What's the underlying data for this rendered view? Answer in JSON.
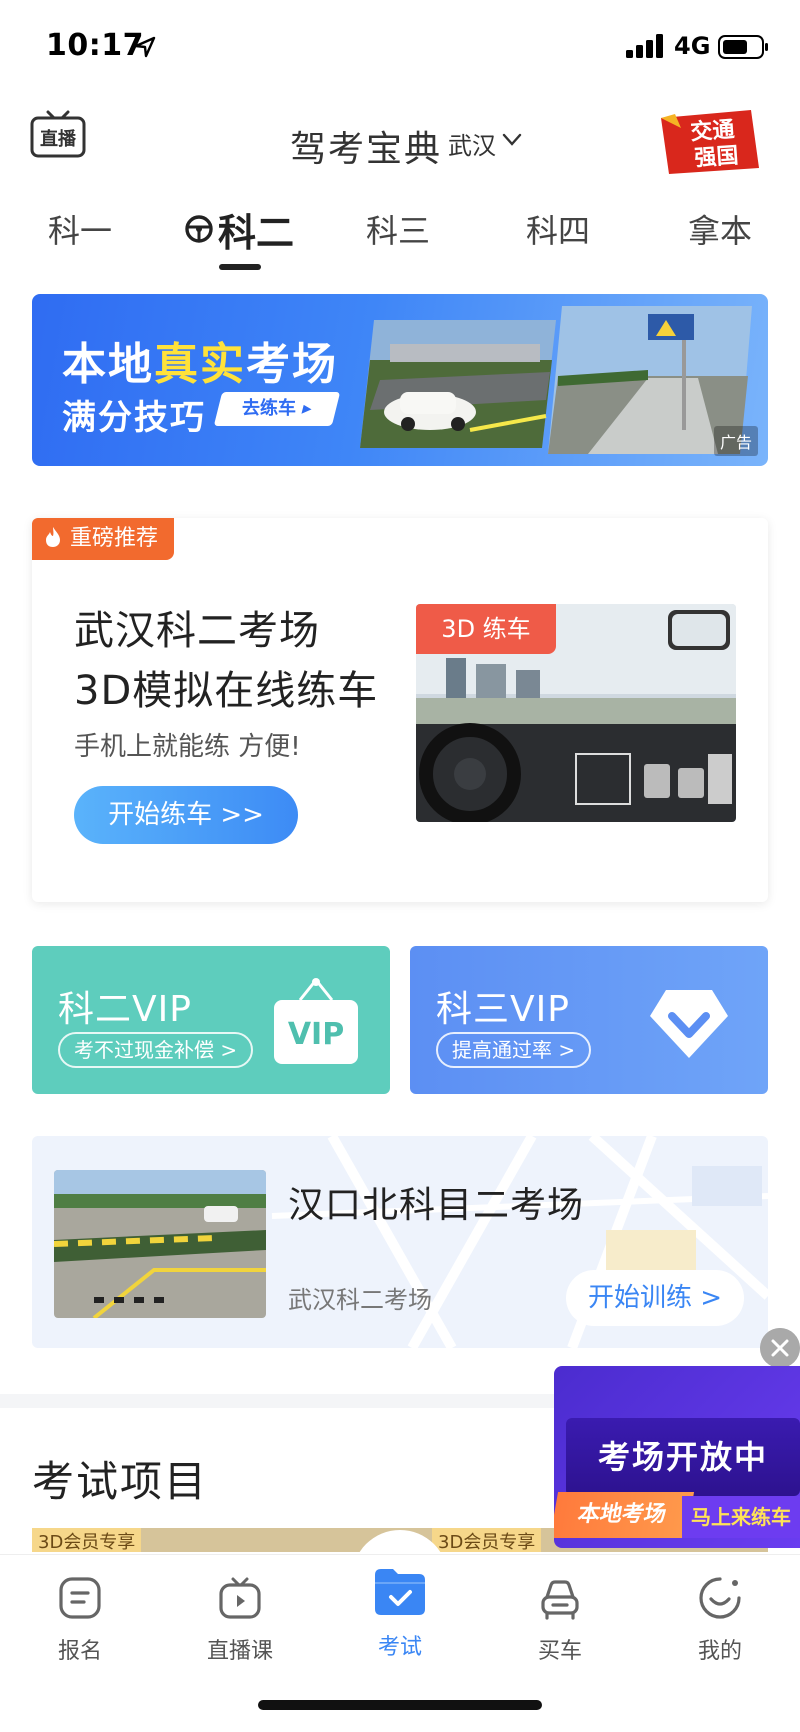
{
  "status_bar": {
    "time": "10:17",
    "network": "4G"
  },
  "header": {
    "live_label": "直播",
    "title": "驾考宝典",
    "city": "武汉",
    "badge_text_1": "交通",
    "badge_text_2": "强国"
  },
  "tabs": [
    {
      "label": "科一",
      "active": false
    },
    {
      "label": "科二",
      "active": true
    },
    {
      "label": "科三",
      "active": false
    },
    {
      "label": "科四",
      "active": false
    },
    {
      "label": "拿本",
      "active": false
    }
  ],
  "banner": {
    "line1_a": "本地",
    "line1_b": "真实",
    "line1_c": "考场",
    "line2": "满分技巧",
    "button": "去练车",
    "ad_label": "广告"
  },
  "recommend": {
    "tag": "重磅推荐",
    "title_line1": "武汉科二考场",
    "title_line2": "3D模拟在线练车",
    "subtitle": "手机上就能练 方便!",
    "button": "开始练车 >>",
    "image_tag": "3D 练车"
  },
  "vip_cards": [
    {
      "title": "科二VIP",
      "pill": "考不过现金补偿 >",
      "badge": "VIP",
      "color": "#5ecdbd"
    },
    {
      "title": "科三VIP",
      "pill": "提高通过率 >",
      "color": "#5c8ff3"
    }
  ],
  "exam_site": {
    "title": "汉口北科目二考场",
    "subtitle": "武汉科二考场",
    "button": "开始训练 >"
  },
  "exam_section": {
    "title": "考试项目",
    "tag_left": "3D会员专享",
    "tag_right": "3D会员专享"
  },
  "float_ad": {
    "main": "考场开放中",
    "left": "本地考场",
    "right": "马上来练车"
  },
  "tabbar": [
    {
      "label": "报名",
      "icon": "signup-icon",
      "active": false
    },
    {
      "label": "直播课",
      "icon": "live-tv-icon",
      "active": false
    },
    {
      "label": "考试",
      "icon": "exam-folder-icon",
      "active": true
    },
    {
      "label": "买车",
      "icon": "car-icon",
      "active": false
    },
    {
      "label": "我的",
      "icon": "profile-smile-icon",
      "active": false
    }
  ],
  "colors": {
    "accent_blue": "#3a86f4",
    "orange_tag": "#f26a2e",
    "highlight_yellow": "#ffe23a"
  }
}
